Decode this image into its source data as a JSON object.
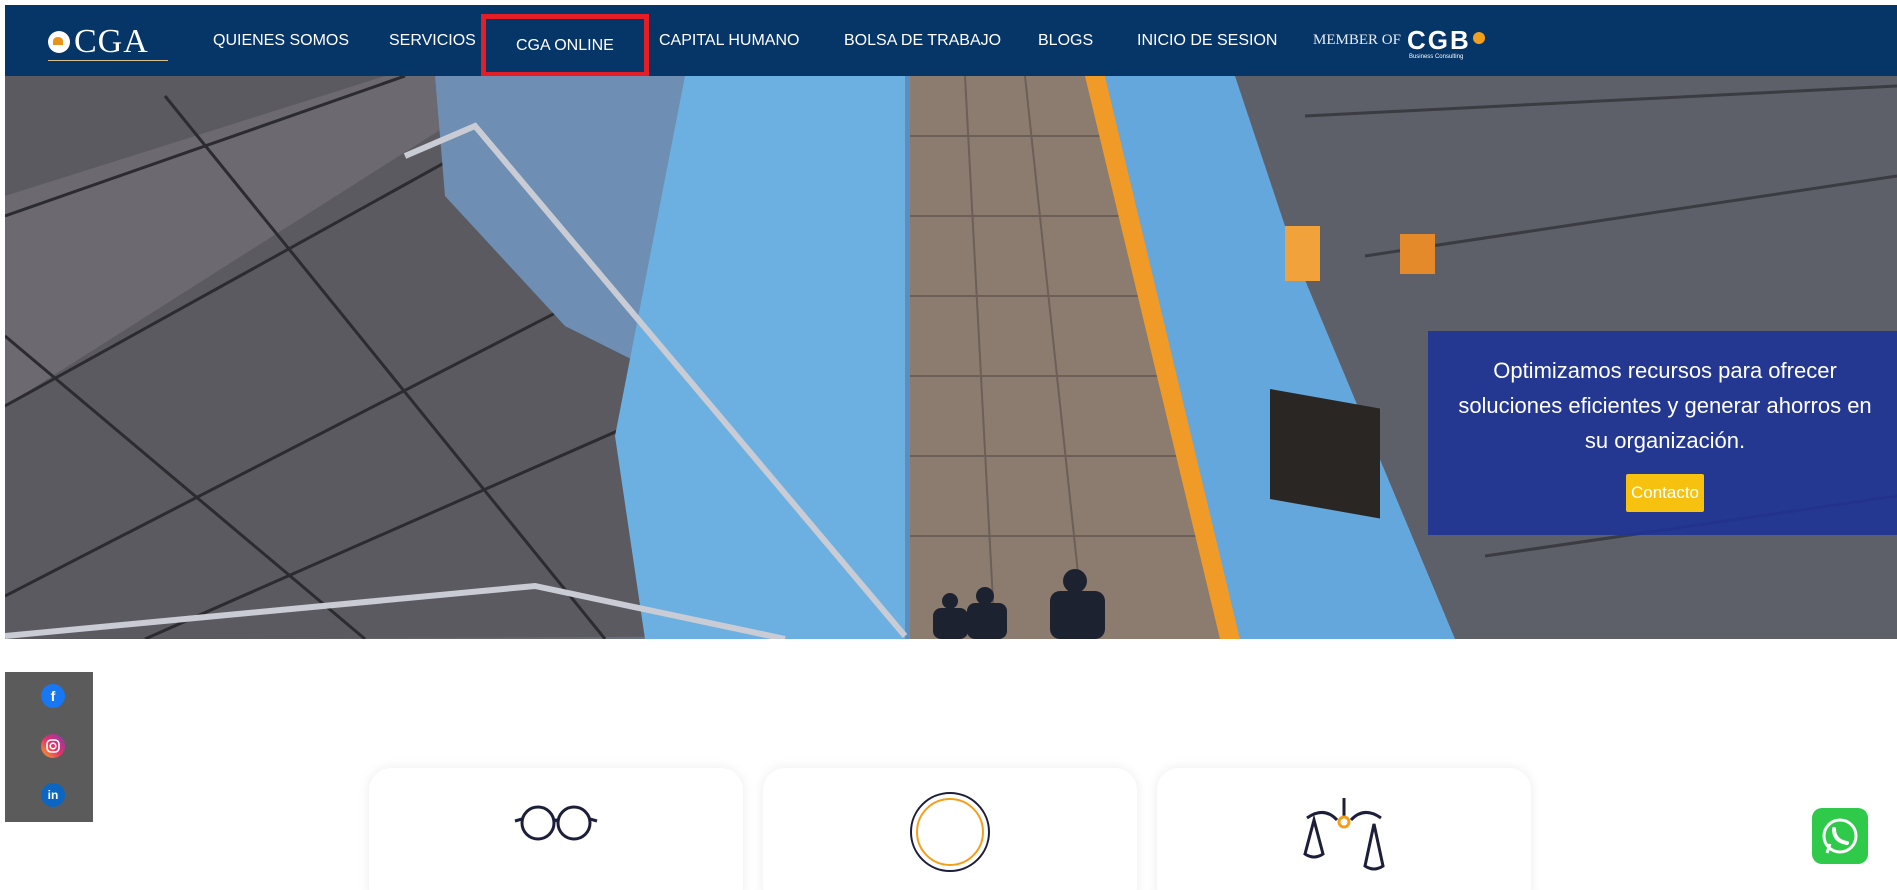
{
  "brand": {
    "logo_text": "CGA"
  },
  "nav": {
    "items": [
      {
        "label": "QUIENES SOMOS"
      },
      {
        "label": "SERVICIOS"
      },
      {
        "label": "CGA ONLINE"
      },
      {
        "label": "CAPITAL HUMANO"
      },
      {
        "label": "BOLSA DE TRABAJO"
      },
      {
        "label": "BLOGS"
      },
      {
        "label": "INICIO DE SESION"
      }
    ],
    "member_label": "MEMBER OF",
    "member_brand": "CGB",
    "member_tagline": "Business Consulting"
  },
  "hero": {
    "promo_text": "Optimizamos recursos para ofrecer soluciones eficientes y generar ahorros en su organización.",
    "cta_label": "Contacto"
  },
  "social": {
    "facebook_glyph": "f",
    "linkedin_glyph": "in"
  },
  "colors": {
    "navbar": "#063567",
    "highlight": "#e51e25",
    "promo_bg": "#1e3296",
    "cta": "#f6c10f",
    "whatsapp": "#2fca4a"
  },
  "icons": {
    "cards": [
      "glasses-icon",
      "circle-icon",
      "scales-icon"
    ]
  }
}
